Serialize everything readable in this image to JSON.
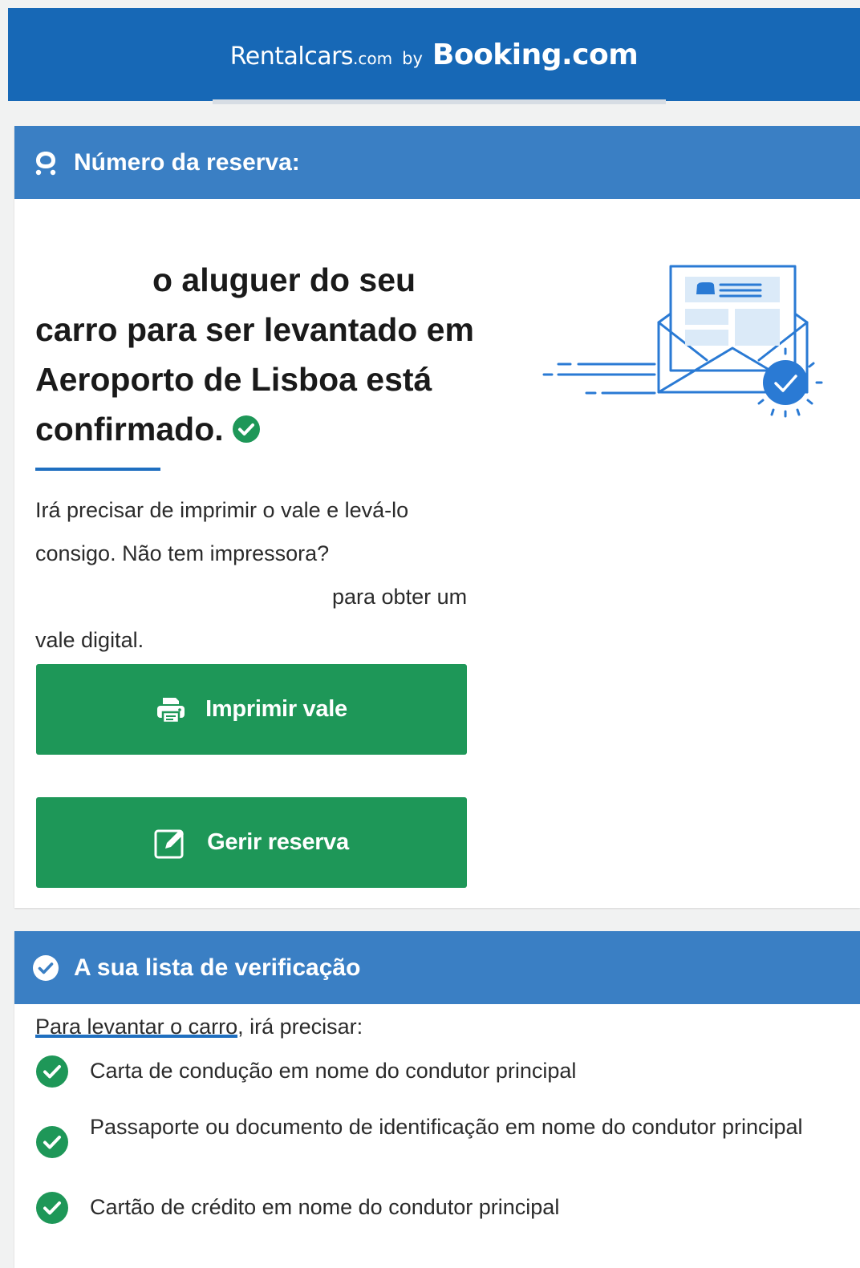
{
  "header": {
    "brand_rentalcars": "Rentalcars",
    "brand_rentalcars_suffix": ".com",
    "brand_by": "by",
    "brand_booking": "Booking.com"
  },
  "reservation": {
    "heading": "Número da reserva:",
    "title_line1": "o aluguer do seu",
    "title_line2": "carro para ser levantado em",
    "title_line3": "Aeroporto de Lisboa está",
    "title_line4": "confirmado.",
    "body_line1": "Irá precisar de imprimir o vale e levá-lo",
    "body_line2": "consigo. Não tem impressora?",
    "body_line3": "para obter um",
    "body_line4": "vale digital.",
    "print_button": "Imprimir vale",
    "manage_button": "Gerir reserva"
  },
  "checklist": {
    "heading": "A sua lista de verificação",
    "intro": "Para levantar o carro, irá precisar:",
    "items": [
      "Carta de condução em nome do condutor principal",
      "Passaporte ou documento de identificação em nome do condutor principal",
      "Cartão de crédito em nome do condutor principal"
    ]
  },
  "colors": {
    "header_blue": "#1768b6",
    "card_head_blue": "#3a7fc4",
    "button_green": "#1e9758",
    "check_green": "#1e9758",
    "accent_blue": "#1f6fc0"
  }
}
